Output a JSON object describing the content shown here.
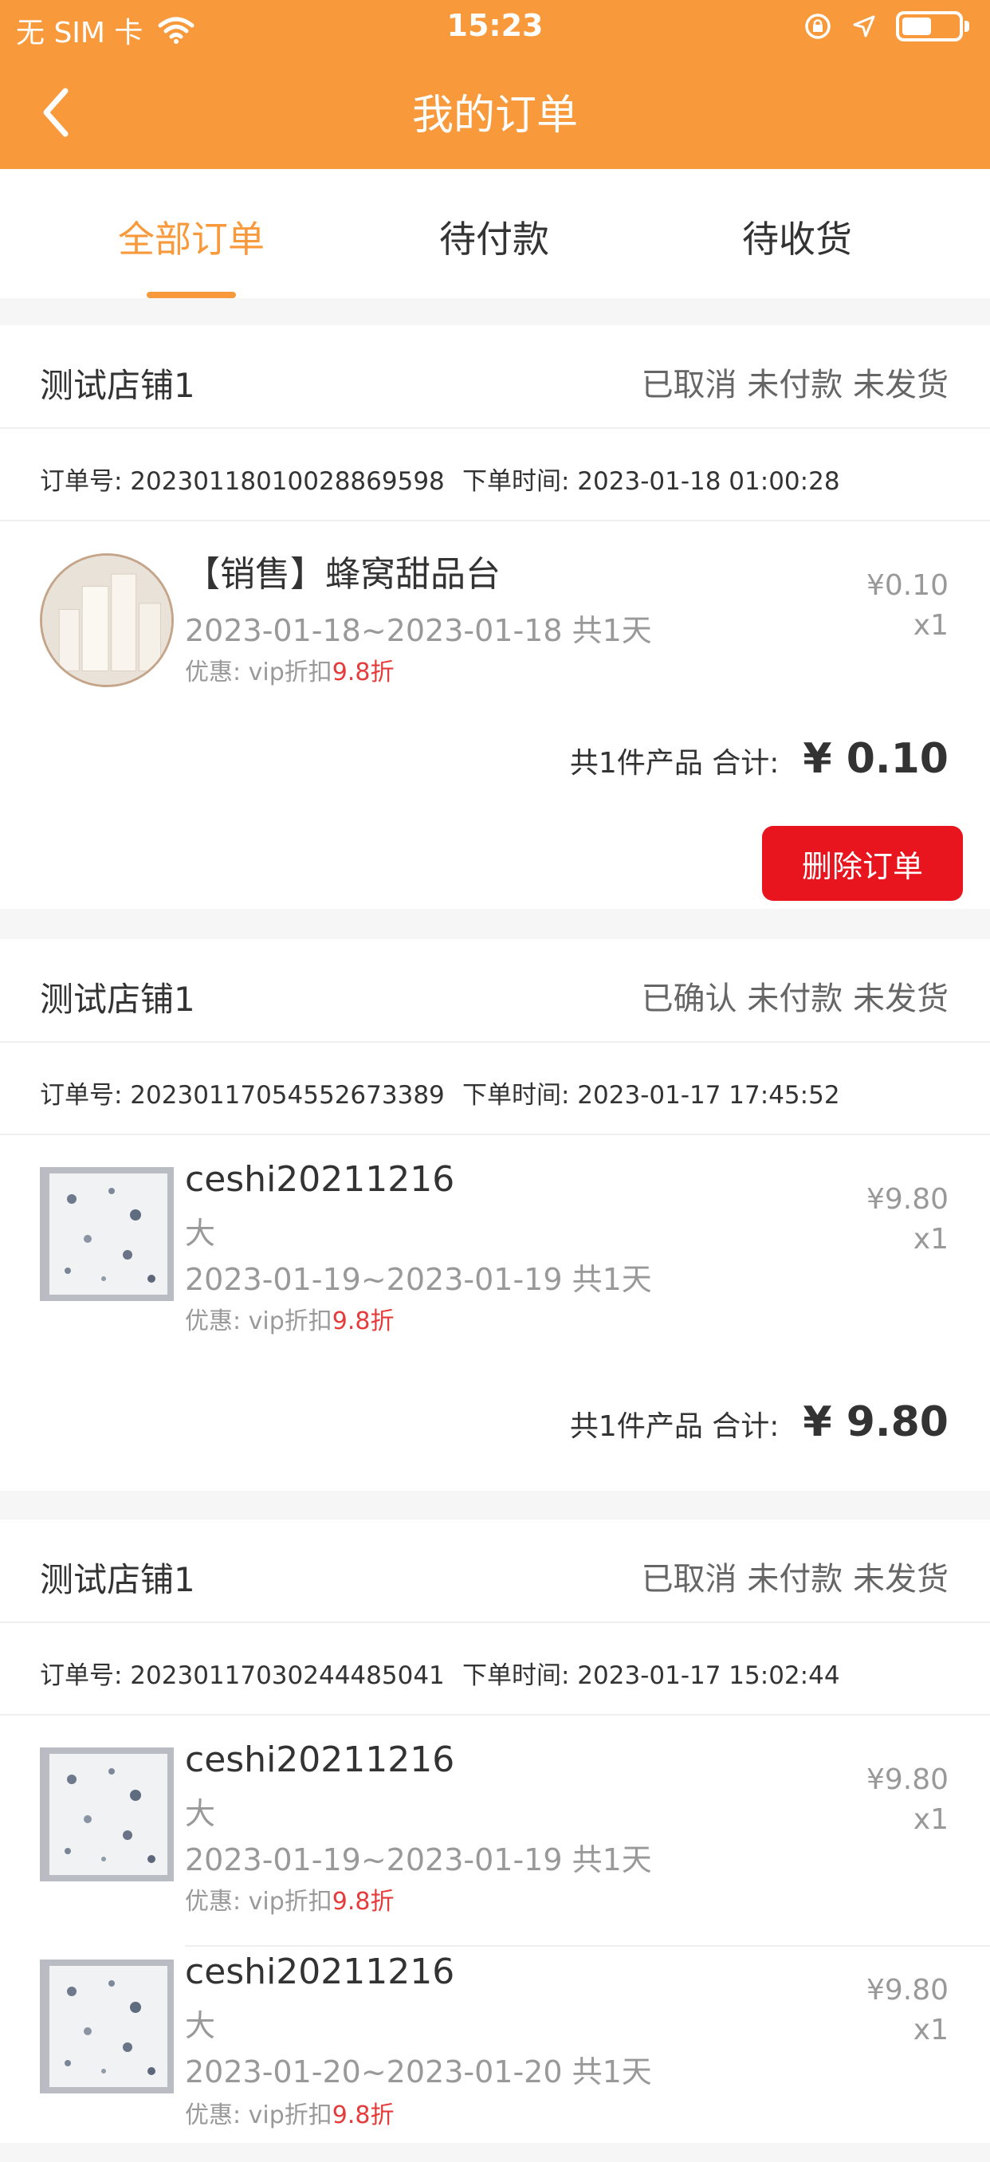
{
  "status_bar": {
    "carrier": "无 SIM 卡",
    "time": "15:23"
  },
  "nav": {
    "title": "我的订单"
  },
  "tabs": [
    {
      "label": "全部订单",
      "active": true
    },
    {
      "label": "待付款",
      "active": false
    },
    {
      "label": "待收货",
      "active": false
    }
  ],
  "colors": {
    "accent": "#f89a3c",
    "delete": "#e8141e",
    "discount": "#e53b3b"
  },
  "orders": [
    {
      "shop": "测试店铺1",
      "status": "已取消  未付款  未发货",
      "order_no": "订单号: 20230118010028869598",
      "order_time": "下单时间: 2023-01-18 01:00:28",
      "items": [
        {
          "name": "【销售】蜂窝甜品台",
          "spec": "",
          "date": "2023-01-18~2023-01-18 共1天",
          "discount_prefix": "优惠: vip折扣",
          "discount_value": "9.8折",
          "price": "¥0.10",
          "qty": "x1",
          "thumb": "dessert-stand"
        }
      ],
      "summary_label": "共1件产品  合计:",
      "summary_total": "¥ 0.10",
      "delete_label": "删除订单"
    },
    {
      "shop": "测试店铺1",
      "status": "已确认  未付款  未发货",
      "order_no": "订单号: 20230117054552673389",
      "order_time": "下单时间: 2023-01-17 17:45:52",
      "items": [
        {
          "name": "ceshi20211216",
          "spec": "大",
          "date": "2023-01-19~2023-01-19 共1天",
          "discount_prefix": "优惠: vip折扣",
          "discount_value": "9.8折",
          "price": "¥9.80",
          "qty": "x1",
          "thumb": "terrazzo-panel"
        }
      ],
      "summary_label": "共1件产品  合计:",
      "summary_total": "¥ 9.80"
    },
    {
      "shop": "测试店铺1",
      "status": "已取消  未付款  未发货",
      "order_no": "订单号: 20230117030244485041",
      "order_time": "下单时间: 2023-01-17 15:02:44",
      "items": [
        {
          "name": "ceshi20211216",
          "spec": "大",
          "date": "2023-01-19~2023-01-19 共1天",
          "discount_prefix": "优惠: vip折扣",
          "discount_value": "9.8折",
          "price": "¥9.80",
          "qty": "x1",
          "thumb": "terrazzo-panel"
        },
        {
          "name": "ceshi20211216",
          "spec": "大",
          "date": "2023-01-20~2023-01-20 共1天",
          "discount_prefix": "优惠: vip折扣",
          "discount_value": "9.8折",
          "price": "¥9.80",
          "qty": "x1",
          "thumb": "terrazzo-panel"
        }
      ]
    }
  ]
}
